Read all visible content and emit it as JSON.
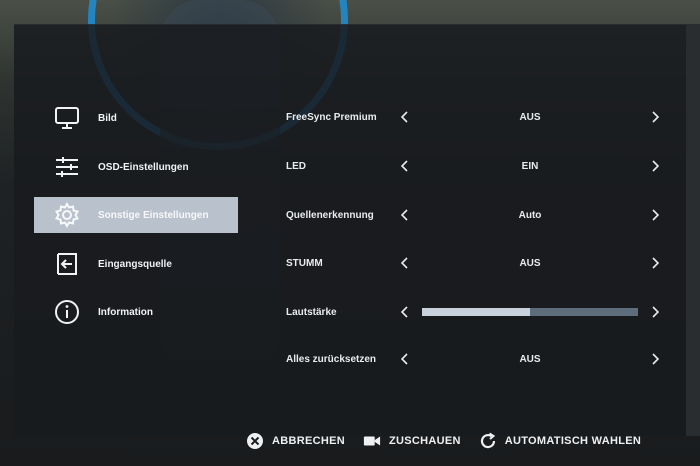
{
  "sidebar": {
    "items": [
      {
        "label": "Bild",
        "icon": "monitor-icon"
      },
      {
        "label": "OSD-Einstellungen",
        "icon": "sliders-icon"
      },
      {
        "label": "Sonstige Einstellungen",
        "icon": "gear-icon",
        "active": true
      },
      {
        "label": "Eingangsquelle",
        "icon": "input-source-icon"
      },
      {
        "label": "Information",
        "icon": "info-icon"
      }
    ]
  },
  "settings": {
    "rows": [
      {
        "name": "FreeSync Premium",
        "value": "AUS"
      },
      {
        "name": "LED",
        "value": "EIN"
      },
      {
        "name": "Quellenerkennung",
        "value": "Auto"
      },
      {
        "name": "STUMM",
        "value": "AUS"
      },
      {
        "name": "Lautstärke",
        "slider_level": 0.5
      },
      {
        "name": "Alles zurücksetzen",
        "value": "AUS"
      }
    ]
  },
  "footer": {
    "cancel_label": "ABBRECHEN",
    "watch_label": "ZUSCHAUEN",
    "auto_label": "AUTOMATISCH WAHLEN"
  },
  "colors": {
    "active_highlight": "#b9c1cc",
    "slider_fill": "#c9d2dc",
    "slider_track": "#5d6d7c",
    "emblem_ring": "#1d8fd6"
  }
}
